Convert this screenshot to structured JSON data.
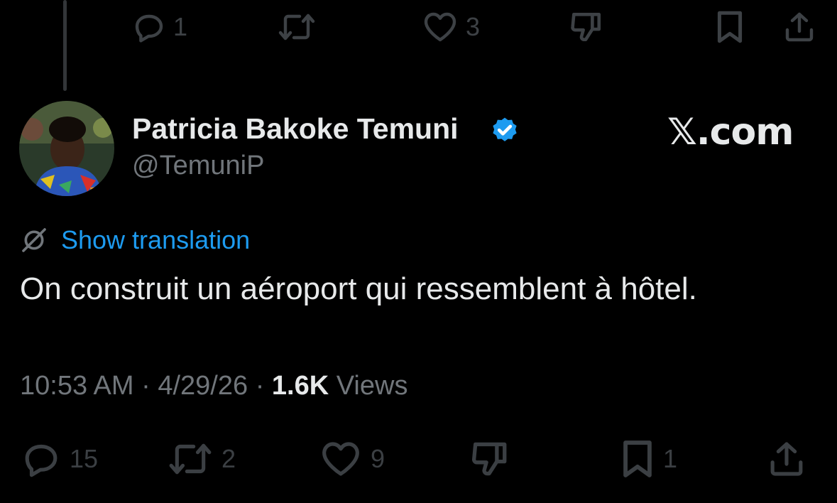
{
  "top_actions": {
    "reply_count": "1",
    "repost_count": "",
    "like_count": "3"
  },
  "author": {
    "name": "Patricia Bakoke Temuni",
    "handle": "@TemuniP",
    "verified": true
  },
  "watermark": "𝕏.com",
  "translate_label": "Show translation",
  "tweet_text": "On construit un aéroport qui ressemblent à hôtel.",
  "meta": {
    "time": "10:53 AM",
    "date": "4/29/26",
    "separator": "·",
    "views_count": "1.6K",
    "views_label": "Views"
  },
  "bottom_actions": {
    "reply_count": "15",
    "repost_count": "2",
    "like_count": "9",
    "bookmark_count": "1"
  },
  "colors": {
    "background": "#000000",
    "primary_text": "#e7e9ea",
    "secondary_text": "#71767b",
    "link": "#1d9bf0",
    "verified_badge": "#1d9bf0",
    "dim_icons": "#3b3f43"
  },
  "icons": [
    "reply-icon",
    "repost-icon",
    "like-icon",
    "dislike-icon",
    "bookmark-icon",
    "share-icon",
    "translate-icon",
    "verified-icon"
  ]
}
